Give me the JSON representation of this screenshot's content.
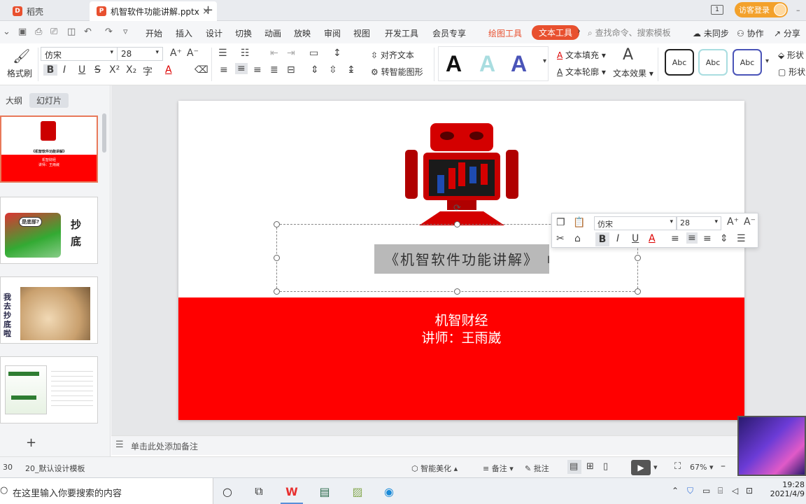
{
  "tabs": {
    "home": "稻壳",
    "document": "机智软件功能讲解.pptx",
    "visitor_login": "访客登录",
    "window_count": "1"
  },
  "menu": {
    "items": [
      "开始",
      "插入",
      "设计",
      "切换",
      "动画",
      "放映",
      "审阅",
      "视图",
      "开发工具",
      "会员专享"
    ],
    "drawing_tools": "绘图工具",
    "text_tools": "文本工具",
    "search_placeholder": "查找命令、搜索模板",
    "sync": "未同步",
    "collab": "协作",
    "share": "分享"
  },
  "ribbon": {
    "format_painter": "格式刷",
    "font_name": "仿宋",
    "font_size": "28",
    "align_text": "对齐文本",
    "smart_shape": "转智能图形",
    "text_fill": "文本填充",
    "text_outline": "文本轮廓",
    "text_effect": "文本效果",
    "style_letter": "A",
    "abc_1": "Abc",
    "abc_2": "Abc",
    "abc_3": "Abc",
    "shape_fill": "形状",
    "shape_outline": "形状"
  },
  "left_panel": {
    "tab_outline": "大纲",
    "tab_slides": "幻灯片",
    "thumb1_title": "《机智软件功能讲解》",
    "thumb1_sub1": "机智财经",
    "thumb1_sub2": "讲师：王雨崴",
    "thumb2_text1": "抄",
    "thumb2_text2": "底",
    "thumb2_bubble": "是底部?",
    "thumb3_text": "我去抄底啦",
    "add": "+"
  },
  "slide": {
    "title": "《机智软件功能讲解》",
    "subtitle_line1": "机智财经",
    "subtitle_line2": "讲师：王雨崴"
  },
  "mini_toolbar": {
    "font_name": "仿宋",
    "font_size": "28"
  },
  "notes": {
    "placeholder": "单击此处添加备注"
  },
  "status": {
    "slide_count": "30",
    "template": "20_默认设计模板",
    "smart_beautify": "智能美化",
    "notes_btn": "备注",
    "comments_btn": "批注",
    "zoom": "67%"
  },
  "taskbar": {
    "search_placeholder": "在这里输入你要搜索的内容",
    "time": "19:28",
    "date": "2021/4/9"
  },
  "colors": {
    "accent": "#e8502f",
    "slide_red": "#ff0000"
  }
}
